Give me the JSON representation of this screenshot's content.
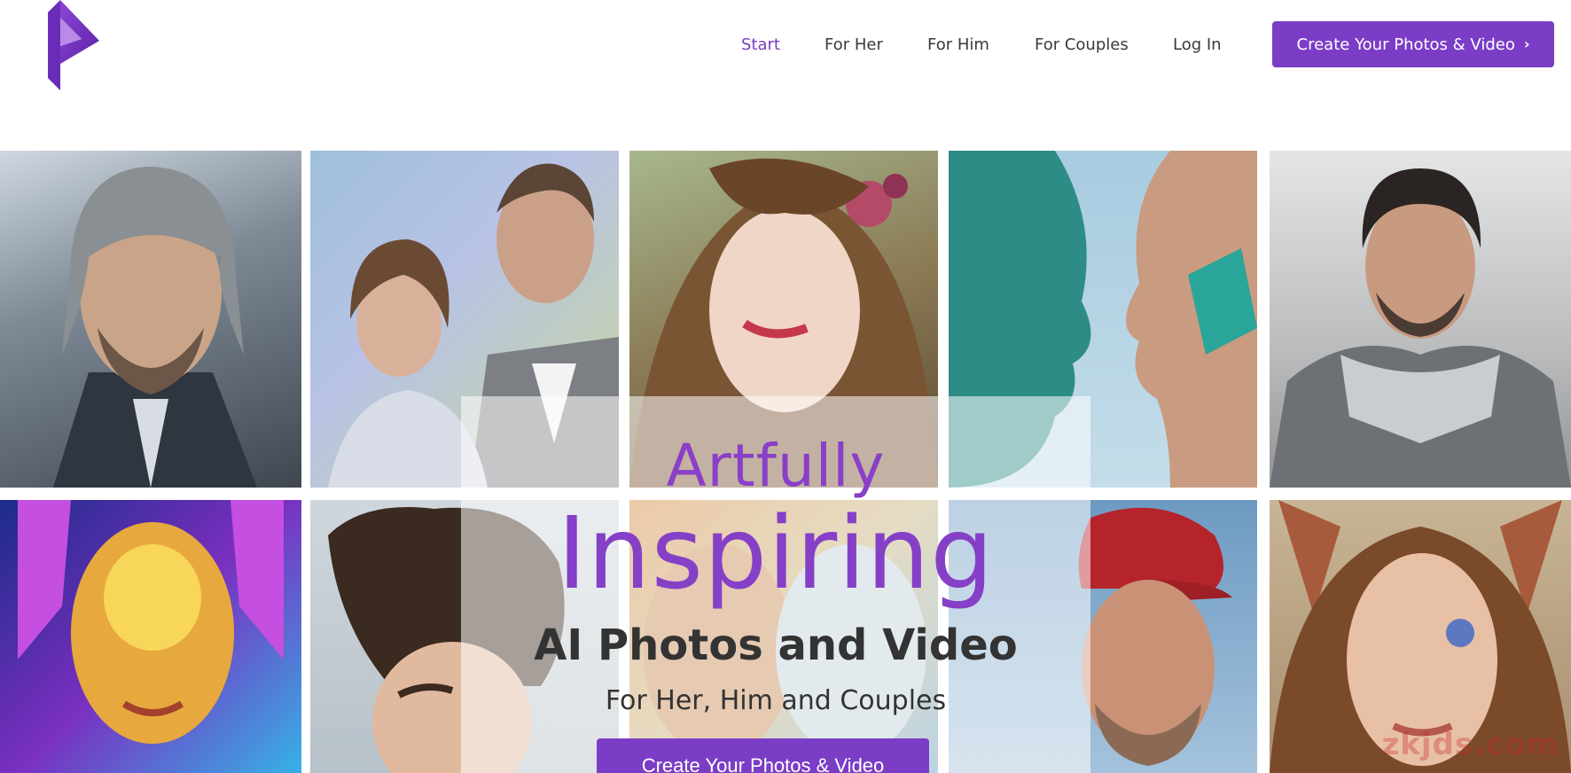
{
  "header": {
    "logo_icon": "p-logo-icon",
    "nav": [
      {
        "label": "Start",
        "active": true
      },
      {
        "label": "For Her",
        "active": false
      },
      {
        "label": "For Him",
        "active": false
      },
      {
        "label": "For Couples",
        "active": false
      },
      {
        "label": "Log In",
        "active": false
      }
    ],
    "cta_label": "Create Your Photos & Video",
    "cta_icon": "chevron-right-icon"
  },
  "hero": {
    "line1": "Artfully",
    "line2": "Inspiring",
    "line3": "AI Photos and Video",
    "line4": "For Her, Him and Couples",
    "cta_label": "Create Your Photos & Video"
  },
  "gallery": {
    "tiles": [
      {
        "name": "tile-warrior-man"
      },
      {
        "name": "tile-couple-portrait"
      },
      {
        "name": "tile-woman-flowers"
      },
      {
        "name": "tile-faces-profile"
      },
      {
        "name": "tile-armored-hero"
      },
      {
        "name": "tile-cosmic-woman"
      },
      {
        "name": "tile-curly-man"
      },
      {
        "name": "tile-painted-faces"
      },
      {
        "name": "tile-baseball-player"
      },
      {
        "name": "tile-fairy-woman"
      }
    ]
  },
  "watermark": "zkjds.com",
  "colors": {
    "accent": "#7b3dc6",
    "nav_active": "#7a3cc4",
    "text_dark": "#333333"
  }
}
